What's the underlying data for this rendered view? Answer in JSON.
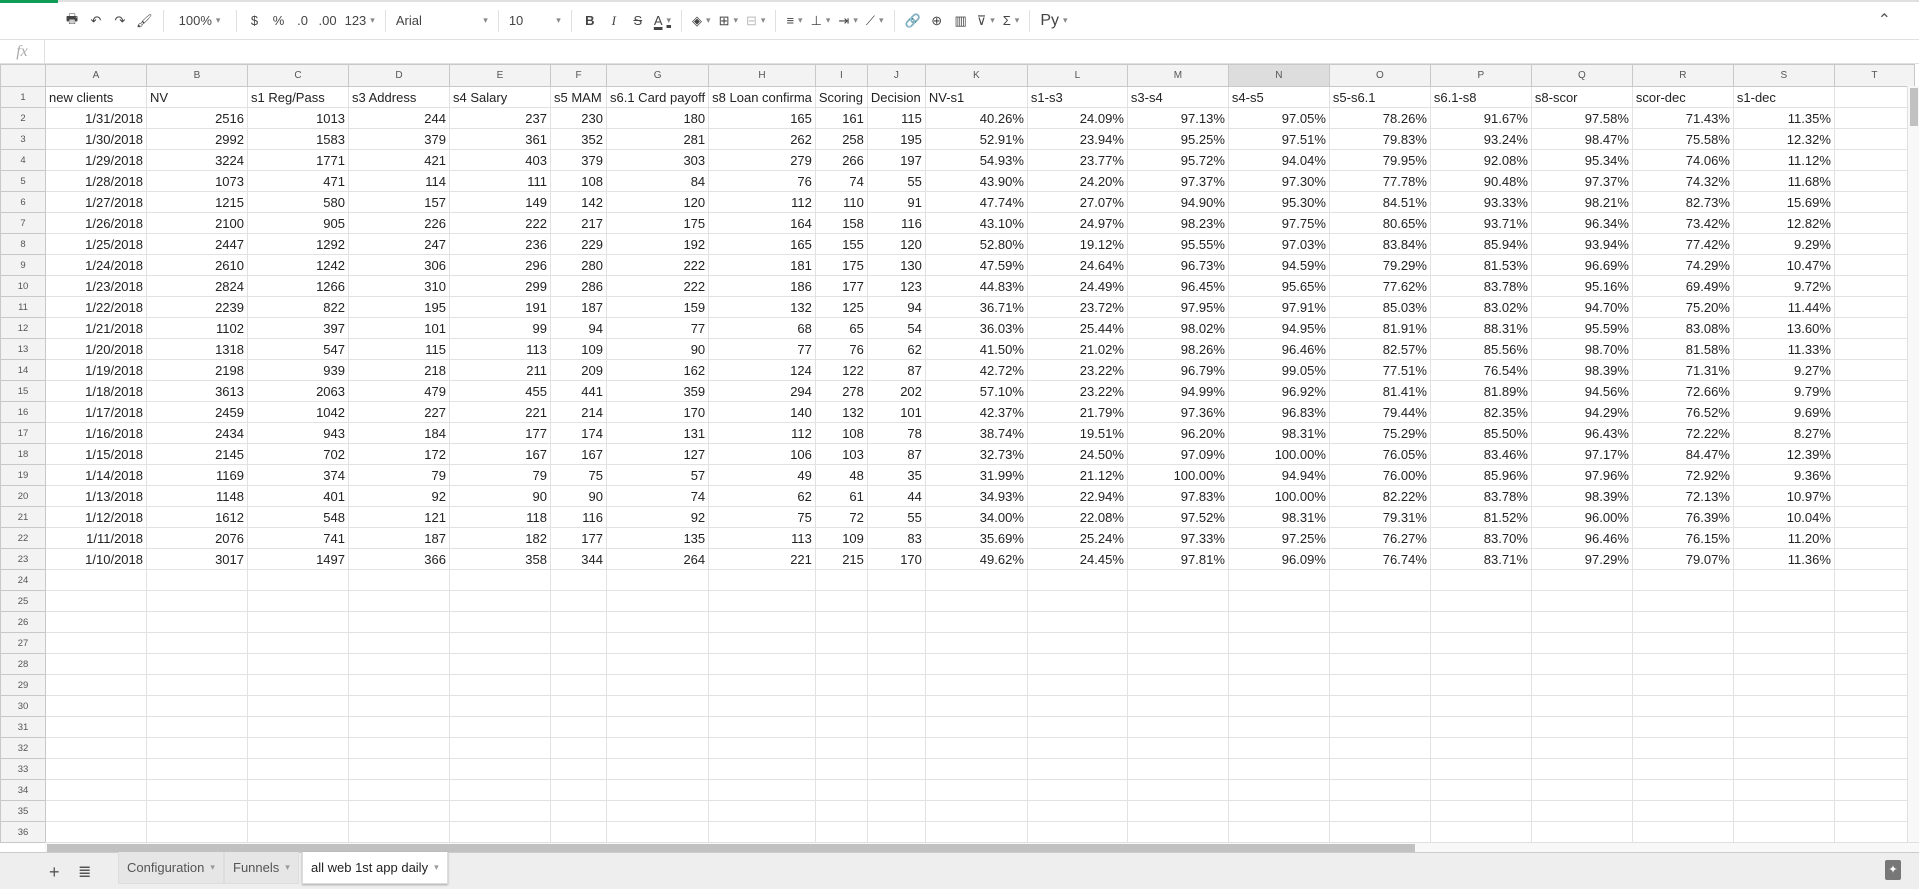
{
  "toolbar": {
    "zoom": "100%",
    "currency": "$",
    "percent": "%",
    "dec_decrease": ".0",
    "dec_increase": ".00",
    "more_formats": "123",
    "font": "Arial",
    "font_size": "10",
    "bold": "B",
    "italic": "I",
    "strike": "S",
    "text_color": "A",
    "input_tools": "Ру"
  },
  "formula_bar": {
    "fx": "fx",
    "value": ""
  },
  "columns": [
    "A",
    "B",
    "C",
    "D",
    "E",
    "F",
    "G",
    "H",
    "I",
    "J",
    "K",
    "L",
    "M",
    "N",
    "O",
    "P",
    "Q",
    "R",
    "S",
    "T"
  ],
  "selected_column": "N",
  "headers": [
    "new clients",
    "NV",
    "s1 Reg/Pass",
    "s3 Address",
    "s4 Salary",
    "s5 MAM",
    "s6.1 Card payoff",
    "s8 Loan confirma",
    "Scoring",
    "Decision",
    "NV-s1",
    "s1-s3",
    "s3-s4",
    "s4-s5",
    "s5-s6.1",
    "s6.1-s8",
    "s8-scor",
    "scor-dec",
    "s1-dec"
  ],
  "rows": [
    [
      "1/31/2018",
      "2516",
      "1013",
      "244",
      "237",
      "230",
      "180",
      "165",
      "161",
      "115",
      "40.26%",
      "24.09%",
      "97.13%",
      "97.05%",
      "78.26%",
      "91.67%",
      "97.58%",
      "71.43%",
      "11.35%"
    ],
    [
      "1/30/2018",
      "2992",
      "1583",
      "379",
      "361",
      "352",
      "281",
      "262",
      "258",
      "195",
      "52.91%",
      "23.94%",
      "95.25%",
      "97.51%",
      "79.83%",
      "93.24%",
      "98.47%",
      "75.58%",
      "12.32%"
    ],
    [
      "1/29/2018",
      "3224",
      "1771",
      "421",
      "403",
      "379",
      "303",
      "279",
      "266",
      "197",
      "54.93%",
      "23.77%",
      "95.72%",
      "94.04%",
      "79.95%",
      "92.08%",
      "95.34%",
      "74.06%",
      "11.12%"
    ],
    [
      "1/28/2018",
      "1073",
      "471",
      "114",
      "111",
      "108",
      "84",
      "76",
      "74",
      "55",
      "43.90%",
      "24.20%",
      "97.37%",
      "97.30%",
      "77.78%",
      "90.48%",
      "97.37%",
      "74.32%",
      "11.68%"
    ],
    [
      "1/27/2018",
      "1215",
      "580",
      "157",
      "149",
      "142",
      "120",
      "112",
      "110",
      "91",
      "47.74%",
      "27.07%",
      "94.90%",
      "95.30%",
      "84.51%",
      "93.33%",
      "98.21%",
      "82.73%",
      "15.69%"
    ],
    [
      "1/26/2018",
      "2100",
      "905",
      "226",
      "222",
      "217",
      "175",
      "164",
      "158",
      "116",
      "43.10%",
      "24.97%",
      "98.23%",
      "97.75%",
      "80.65%",
      "93.71%",
      "96.34%",
      "73.42%",
      "12.82%"
    ],
    [
      "1/25/2018",
      "2447",
      "1292",
      "247",
      "236",
      "229",
      "192",
      "165",
      "155",
      "120",
      "52.80%",
      "19.12%",
      "95.55%",
      "97.03%",
      "83.84%",
      "85.94%",
      "93.94%",
      "77.42%",
      "9.29%"
    ],
    [
      "1/24/2018",
      "2610",
      "1242",
      "306",
      "296",
      "280",
      "222",
      "181",
      "175",
      "130",
      "47.59%",
      "24.64%",
      "96.73%",
      "94.59%",
      "79.29%",
      "81.53%",
      "96.69%",
      "74.29%",
      "10.47%"
    ],
    [
      "1/23/2018",
      "2824",
      "1266",
      "310",
      "299",
      "286",
      "222",
      "186",
      "177",
      "123",
      "44.83%",
      "24.49%",
      "96.45%",
      "95.65%",
      "77.62%",
      "83.78%",
      "95.16%",
      "69.49%",
      "9.72%"
    ],
    [
      "1/22/2018",
      "2239",
      "822",
      "195",
      "191",
      "187",
      "159",
      "132",
      "125",
      "94",
      "36.71%",
      "23.72%",
      "97.95%",
      "97.91%",
      "85.03%",
      "83.02%",
      "94.70%",
      "75.20%",
      "11.44%"
    ],
    [
      "1/21/2018",
      "1102",
      "397",
      "101",
      "99",
      "94",
      "77",
      "68",
      "65",
      "54",
      "36.03%",
      "25.44%",
      "98.02%",
      "94.95%",
      "81.91%",
      "88.31%",
      "95.59%",
      "83.08%",
      "13.60%"
    ],
    [
      "1/20/2018",
      "1318",
      "547",
      "115",
      "113",
      "109",
      "90",
      "77",
      "76",
      "62",
      "41.50%",
      "21.02%",
      "98.26%",
      "96.46%",
      "82.57%",
      "85.56%",
      "98.70%",
      "81.58%",
      "11.33%"
    ],
    [
      "1/19/2018",
      "2198",
      "939",
      "218",
      "211",
      "209",
      "162",
      "124",
      "122",
      "87",
      "42.72%",
      "23.22%",
      "96.79%",
      "99.05%",
      "77.51%",
      "76.54%",
      "98.39%",
      "71.31%",
      "9.27%"
    ],
    [
      "1/18/2018",
      "3613",
      "2063",
      "479",
      "455",
      "441",
      "359",
      "294",
      "278",
      "202",
      "57.10%",
      "23.22%",
      "94.99%",
      "96.92%",
      "81.41%",
      "81.89%",
      "94.56%",
      "72.66%",
      "9.79%"
    ],
    [
      "1/17/2018",
      "2459",
      "1042",
      "227",
      "221",
      "214",
      "170",
      "140",
      "132",
      "101",
      "42.37%",
      "21.79%",
      "97.36%",
      "96.83%",
      "79.44%",
      "82.35%",
      "94.29%",
      "76.52%",
      "9.69%"
    ],
    [
      "1/16/2018",
      "2434",
      "943",
      "184",
      "177",
      "174",
      "131",
      "112",
      "108",
      "78",
      "38.74%",
      "19.51%",
      "96.20%",
      "98.31%",
      "75.29%",
      "85.50%",
      "96.43%",
      "72.22%",
      "8.27%"
    ],
    [
      "1/15/2018",
      "2145",
      "702",
      "172",
      "167",
      "167",
      "127",
      "106",
      "103",
      "87",
      "32.73%",
      "24.50%",
      "97.09%",
      "100.00%",
      "76.05%",
      "83.46%",
      "97.17%",
      "84.47%",
      "12.39%"
    ],
    [
      "1/14/2018",
      "1169",
      "374",
      "79",
      "79",
      "75",
      "57",
      "49",
      "48",
      "35",
      "31.99%",
      "21.12%",
      "100.00%",
      "94.94%",
      "76.00%",
      "85.96%",
      "97.96%",
      "72.92%",
      "9.36%"
    ],
    [
      "1/13/2018",
      "1148",
      "401",
      "92",
      "90",
      "90",
      "74",
      "62",
      "61",
      "44",
      "34.93%",
      "22.94%",
      "97.83%",
      "100.00%",
      "82.22%",
      "83.78%",
      "98.39%",
      "72.13%",
      "10.97%"
    ],
    [
      "1/12/2018",
      "1612",
      "548",
      "121",
      "118",
      "116",
      "92",
      "75",
      "72",
      "55",
      "34.00%",
      "22.08%",
      "97.52%",
      "98.31%",
      "79.31%",
      "81.52%",
      "96.00%",
      "76.39%",
      "10.04%"
    ],
    [
      "1/11/2018",
      "2076",
      "741",
      "187",
      "182",
      "177",
      "135",
      "113",
      "109",
      "83",
      "35.69%",
      "25.24%",
      "97.33%",
      "97.25%",
      "76.27%",
      "83.70%",
      "96.46%",
      "76.15%",
      "11.20%"
    ],
    [
      "1/10/2018",
      "3017",
      "1497",
      "366",
      "358",
      "344",
      "264",
      "221",
      "215",
      "170",
      "49.62%",
      "24.45%",
      "97.81%",
      "96.09%",
      "76.74%",
      "83.71%",
      "97.29%",
      "79.07%",
      "11.36%"
    ]
  ],
  "total_rows": 36,
  "sheets": [
    {
      "label": "Configuration"
    },
    {
      "label": "Funnels"
    },
    {
      "label": "all web 1st app daily",
      "active": true
    }
  ]
}
